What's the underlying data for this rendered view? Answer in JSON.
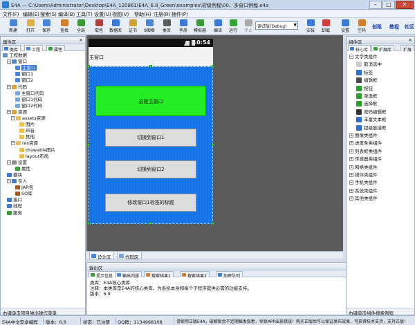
{
  "window": {
    "title": "E4A — C:\\Users\\Administrator\\Desktop\\E4A_120861\\E4A_6.8_Green\\examples\\初级例程\\00、多窗口例程.e4a",
    "min": "–",
    "max": "□",
    "close": "✕"
  },
  "menu": [
    "文件(F)",
    "编辑(E)",
    "搜索(S)",
    "编译(B)",
    "工具(T)",
    "设置(U)",
    "视图(V)",
    "帮助(H)",
    "注册(R)",
    "插件(P)"
  ],
  "toolbar": {
    "buttons": [
      "新建",
      "打开",
      "保存",
      "查找",
      "全局",
      "取色",
      "数据库",
      "证书",
      "9图框",
      "类库",
      "手册",
      "模拟器",
      "编译",
      "运行",
      "停止",
      "安装",
      "卸载",
      "设置",
      "空码"
    ],
    "config_select": "调试版(Debug)",
    "links": [
      "创租",
      "教程",
      "社区"
    ]
  },
  "left_panel": {
    "header": "属性区",
    "tabs": [
      "类库",
      "工程",
      "属性"
    ],
    "tree": [
      {
        "label": "工程数据",
        "indent": 0,
        "exp": "",
        "icon": "#6a8fbf"
      },
      {
        "label": "窗口",
        "indent": 1,
        "exp": "−",
        "icon": "#4b86d6"
      },
      {
        "label": "主窗口",
        "indent": 3,
        "exp": "",
        "icon": "#4b86d6",
        "selected": true
      },
      {
        "label": "窗口1",
        "indent": 3,
        "exp": "",
        "icon": "#4b86d6"
      },
      {
        "label": "窗口2",
        "indent": 3,
        "exp": "",
        "icon": "#4b86d6"
      },
      {
        "label": "代码",
        "indent": 1,
        "exp": "−",
        "icon": "#e0a030"
      },
      {
        "label": "主窗口代码",
        "indent": 3,
        "exp": "",
        "icon": "#7aa6d8"
      },
      {
        "label": "窗口1代码",
        "indent": 3,
        "exp": "",
        "icon": "#7aa6d8"
      },
      {
        "label": "窗口2代码",
        "indent": 3,
        "exp": "",
        "icon": "#7aa6d8"
      },
      {
        "label": "资源",
        "indent": 1,
        "exp": "−",
        "icon": "#e0a030"
      },
      {
        "label": "assets资源",
        "indent": 2,
        "exp": "−",
        "icon": "#e8c050"
      },
      {
        "label": "图片",
        "indent": 4,
        "exp": "",
        "icon": "#e8c050"
      },
      {
        "label": "声音",
        "indent": 4,
        "exp": "",
        "icon": "#e8c050"
      },
      {
        "label": "其他",
        "indent": 4,
        "exp": "",
        "icon": "#e8c050"
      },
      {
        "label": "res资源",
        "indent": 2,
        "exp": "−",
        "icon": "#e8c050"
      },
      {
        "label": "drawable图片",
        "indent": 4,
        "exp": "",
        "icon": "#e8c050"
      },
      {
        "label": "layout布局",
        "indent": 4,
        "exp": "",
        "icon": "#e8c050"
      },
      {
        "label": "设置",
        "indent": 1,
        "exp": "−",
        "icon": "#8a8a8a"
      },
      {
        "label": "属性",
        "indent": 3,
        "exp": "",
        "icon": "#3aa03a"
      },
      {
        "label": "模块",
        "indent": 1,
        "exp": "",
        "icon": "#3a7ad6"
      },
      {
        "label": "引入",
        "indent": 1,
        "exp": "−",
        "icon": "#3a7ad6"
      },
      {
        "label": "JAR包",
        "indent": 3,
        "exp": "",
        "icon": "#a05a2a"
      },
      {
        "label": "SO库",
        "indent": 3,
        "exp": "",
        "icon": "#a05a2a"
      },
      {
        "label": "接口",
        "indent": 1,
        "exp": "",
        "icon": "#3a7ad6"
      },
      {
        "label": "线程",
        "indent": 1,
        "exp": "",
        "icon": "#3a7ad6"
      },
      {
        "label": "服务",
        "indent": 1,
        "exp": "",
        "icon": "#3a9a3a"
      }
    ],
    "footer": "右键单击项目弹出操作菜单"
  },
  "phone": {
    "time": "10:54",
    "title": "主窗口",
    "label_text": "这是主窗口",
    "buttons": [
      "切换到窗口1",
      "切换到窗口2",
      "修改窗口1标签的标题"
    ]
  },
  "designer_tabs": [
    "设计区",
    "代码区"
  ],
  "output": {
    "header": "输出区",
    "tabs": [
      "提示信息",
      "输出内容",
      "搜索结果1",
      "搜索结果2",
      "加密队列"
    ],
    "lines": [
      "类库：E4A核心类库",
      "注释：本类库是E4A的核心类库，为系统本身和每个子程序提供必需的功能支持。",
      "版本：6.8"
    ]
  },
  "right_panel": {
    "header": "组件区",
    "tabs": [
      "核心库",
      "扩展库"
    ],
    "side_tab": "扩展",
    "components": [
      {
        "label": "文字类组件",
        "exp": "−",
        "icon": null,
        "indent": 0
      },
      {
        "label": "取消选中",
        "exp": "",
        "icon": "#cccccc",
        "indent": 1
      },
      {
        "label": "标签",
        "exp": "",
        "icon": "#2f6fd0",
        "indent": 1
      },
      {
        "label": "编辑框",
        "exp": "",
        "icon": "#4a4a4a",
        "indent": 1
      },
      {
        "label": "按钮",
        "exp": "",
        "icon": "#2aa02a",
        "indent": 1
      },
      {
        "label": "单选框",
        "exp": "",
        "icon": "#2aa02a",
        "indent": 1
      },
      {
        "label": "选择框",
        "exp": "",
        "icon": "#2aa02a",
        "indent": 1
      },
      {
        "label": "密码编辑框",
        "exp": "",
        "icon": "#333333",
        "indent": 1
      },
      {
        "label": "丰富文本框",
        "exp": "",
        "icon": "#2f6fd0",
        "indent": 1
      },
      {
        "label": "超级链接框",
        "exp": "",
        "icon": "#2f6fd0",
        "indent": 1
      },
      {
        "label": "图像类组件",
        "exp": "+",
        "icon": null,
        "indent": 0
      },
      {
        "label": "进度条类组件",
        "exp": "+",
        "icon": null,
        "indent": 0
      },
      {
        "label": "列表框类组件",
        "exp": "+",
        "icon": null,
        "indent": 0
      },
      {
        "label": "传感器类组件",
        "exp": "+",
        "icon": null,
        "indent": 0
      },
      {
        "label": "网络类组件",
        "exp": "+",
        "icon": null,
        "indent": 0
      },
      {
        "label": "媒体类组件",
        "exp": "+",
        "icon": null,
        "indent": 0
      },
      {
        "label": "手机类组件",
        "exp": "+",
        "icon": null,
        "indent": 0
      },
      {
        "label": "系统类组件",
        "exp": "+",
        "icon": null,
        "indent": 0
      },
      {
        "label": "其他类组件",
        "exp": "+",
        "icon": null,
        "indent": 0
      }
    ],
    "footer": "右键单击组件搜索例程"
  },
  "status": {
    "items": [
      "E4A中文安卓编程",
      "版本：6.8",
      "状态：已注册",
      "QQ群：1134968108",
      "请使用正版E4A，破解版会不定期触发隐患，导致APP出现错误！购买正版后可以保证发布效果，可获得技术支持，支持正版！"
    ]
  }
}
